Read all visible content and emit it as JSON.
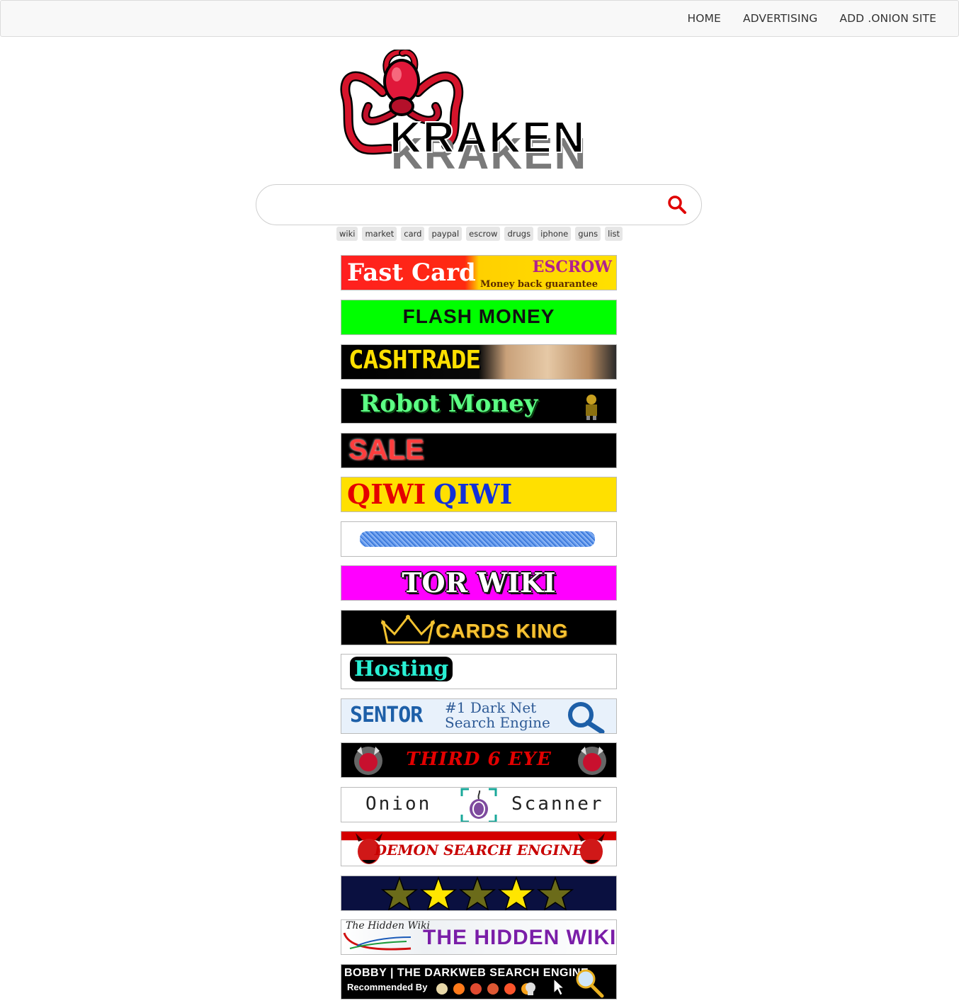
{
  "nav": {
    "links": [
      "HOME",
      "ADVERTISING",
      "ADD .ONION SITE"
    ]
  },
  "logo": {
    "text": "KRAKEN",
    "icon": "octopus-icon"
  },
  "search": {
    "value": "",
    "placeholder": "",
    "icon": "search-icon",
    "icon_color": "#e00000"
  },
  "tags": [
    "wiki",
    "market",
    "card",
    "paypal",
    "escrow",
    "drugs",
    "iphone",
    "guns",
    "list"
  ],
  "banners": {
    "fast_card": {
      "title": "Fast Card",
      "escrow": "ESCROW",
      "subtitle": "Money back guarantee"
    },
    "flash_money": {
      "title": "FLASH MONEY"
    },
    "cashtrade": {
      "title": "CASHTRADE"
    },
    "robot_money": {
      "title": "Robot Money"
    },
    "sale": {
      "title": "SALE"
    },
    "qiwi": {
      "left": "QIWI",
      "right": "QIWI"
    },
    "blue_scribble": {},
    "tor_wiki": {
      "title": "TOR WIKI"
    },
    "cards_king": {
      "title": "CARDS KING"
    },
    "hosting": {
      "title": "Hosting"
    },
    "sentor": {
      "logo": "SENTOR",
      "line1": "#1 Dark Net",
      "line2": "Search Engine"
    },
    "third_eye": {
      "title": "THIRD 6 EYE"
    },
    "onion_scanner": {
      "left": "Onion",
      "right": "Scanner"
    },
    "demon": {
      "title": "DEMON SEARCH ENGINE"
    },
    "stars": {
      "rating": 5
    },
    "hidden_wiki": {
      "logo": "The Hidden Wiki",
      "title": "THE HIDDEN WIKI"
    },
    "bobby": {
      "line1": "BOBBY | THE DARKWEB SEARCH ENGINE",
      "line2": "Recommended By"
    }
  },
  "colors": {
    "accent_red": "#e00000",
    "navbar_bg": "#f8f8f8",
    "flash_green": "#00ff00",
    "tor_magenta": "#ff00ff",
    "qiwi_yellow": "#ffe000"
  }
}
